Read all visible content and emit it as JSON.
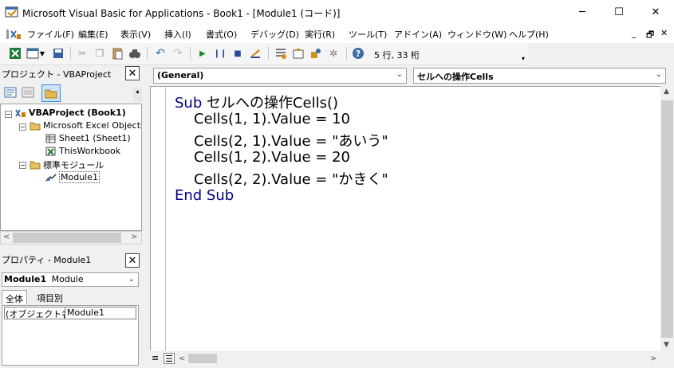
{
  "window": {
    "title": "Microsoft Visual Basic for Applications - Book1 - [Module1 (コード)]",
    "minimize": "─",
    "maximize": "☐",
    "close": "✕"
  },
  "menu": {
    "items": [
      "ファイル(F)",
      "編集(E)",
      "表示(V)",
      "挿入(I)",
      "書式(O)",
      "デバッグ(D)",
      "実行(R)",
      "ツール(T)",
      "アドイン(A)",
      "ウィンドウ(W)",
      "ヘルプ(H)"
    ],
    "mdi_min": "_",
    "mdi_restore": "🗗",
    "mdi_close": "✕"
  },
  "toolbar": {
    "position": "5 行, 33 桁"
  },
  "project": {
    "title": "プロジェクト - VBAProject",
    "close": "✕",
    "tree": {
      "root": "VBAProject (Book1)",
      "excel_objects": "Microsoft Excel Objects",
      "sheet1": "Sheet1 (Sheet1)",
      "thisworkbook": "ThisWorkbook",
      "modules": "標準モジュール",
      "module1": "Module1"
    }
  },
  "properties": {
    "title": "プロパティ - Module1",
    "close": "✕",
    "object_bold": "Module1",
    "object_type": "Module",
    "tab_all": "全体",
    "tab_category": "項目別",
    "row_name": "(オブジェクト名)",
    "row_value": "Module1"
  },
  "code": {
    "object_combo": "(General)",
    "proc_combo": "セルへの操作Cells",
    "lines": [
      {
        "kw": "Sub",
        "text": " セルへの操作Cells()",
        "indent": false
      },
      {
        "kw": "",
        "text": "Cells(1, 1).Value = 10",
        "indent": true
      },
      {
        "kw": "",
        "text": "Cells(2, 1).Value = \"あいう\"",
        "indent": true
      },
      {
        "kw": "",
        "text": "Cells(1, 2).Value = 20",
        "indent": true
      },
      {
        "kw": "",
        "text": "Cells(2, 2).Value = \"かきく\"",
        "indent": true
      },
      {
        "kw": "End Sub",
        "text": "",
        "indent": false
      }
    ]
  },
  "colors": {
    "keyword": "#00008b",
    "background": "#f0f0f0"
  }
}
